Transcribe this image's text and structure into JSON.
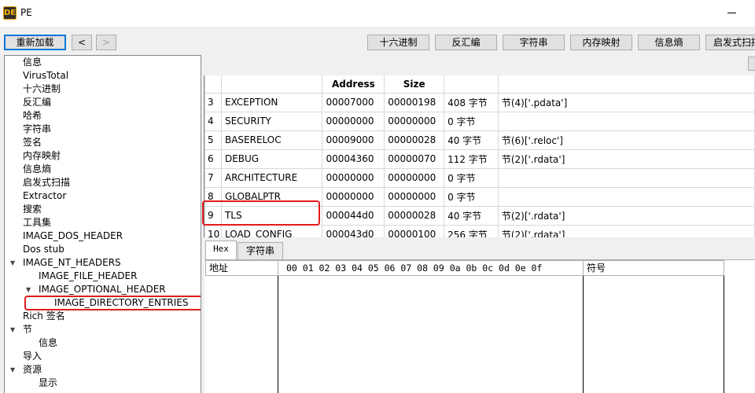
{
  "window": {
    "title": "PE",
    "app_icon_text": "DE"
  },
  "toolbar": {
    "reload": "重新加载",
    "back": "<",
    "forward": ">",
    "buttons": [
      "十六进制",
      "反汇编",
      "字符串",
      "内存映射",
      "信息熵",
      "启发式扫描"
    ]
  },
  "tree": {
    "items": [
      "信息",
      "VirusTotal",
      "十六进制",
      "反汇编",
      "哈希",
      "字符串",
      "签名",
      "内存映射",
      "信息熵",
      "启发式扫描",
      "Extractor",
      "搜索",
      "工具集",
      "IMAGE_DOS_HEADER",
      "Dos stub",
      "IMAGE_NT_HEADERS",
      "IMAGE_FILE_HEADER",
      "IMAGE_OPTIONAL_HEADER",
      "IMAGE_DIRECTORY_ENTRIES",
      "Rich 签名",
      "节",
      "信息",
      "导入",
      "资源",
      "显示"
    ],
    "selected": "IMAGE_DIRECTORY_ENTRIES"
  },
  "directory_table": {
    "headers": [
      "",
      "",
      "Address",
      "Size",
      "",
      ""
    ],
    "rows": [
      [
        "3",
        "EXCEPTION",
        "00007000",
        "00000198",
        "408 字节",
        "节(4)['.pdata']"
      ],
      [
        "4",
        "SECURITY",
        "00000000",
        "00000000",
        "0 字节",
        ""
      ],
      [
        "5",
        "BASERELOC",
        "00009000",
        "00000028",
        "40 字节",
        "节(6)['.reloc']"
      ],
      [
        "6",
        "DEBUG",
        "00004360",
        "00000070",
        "112 字节",
        "节(2)['.rdata']"
      ],
      [
        "7",
        "ARCHITECTURE",
        "00000000",
        "00000000",
        "0 字节",
        ""
      ],
      [
        "8",
        "GLOBALPTR",
        "00000000",
        "00000000",
        "0 字节",
        ""
      ],
      [
        "9",
        "TLS",
        "000044d0",
        "00000028",
        "40 字节",
        "节(2)['.rdata']"
      ],
      [
        "10",
        "LOAD_CONFIG",
        "000043d0",
        "00000100",
        "256 字节",
        "节(2)['.rdata']"
      ]
    ],
    "highlighted_row": "9"
  },
  "bottom_tabs": {
    "hex": "Hex",
    "strings": "字符串"
  },
  "hex_view": {
    "address_header": "地址",
    "bytes_header": "00 01 02 03 04 05 06 07 08 09 0a 0b 0c 0d 0e 0f",
    "symbol_header": "符号"
  }
}
